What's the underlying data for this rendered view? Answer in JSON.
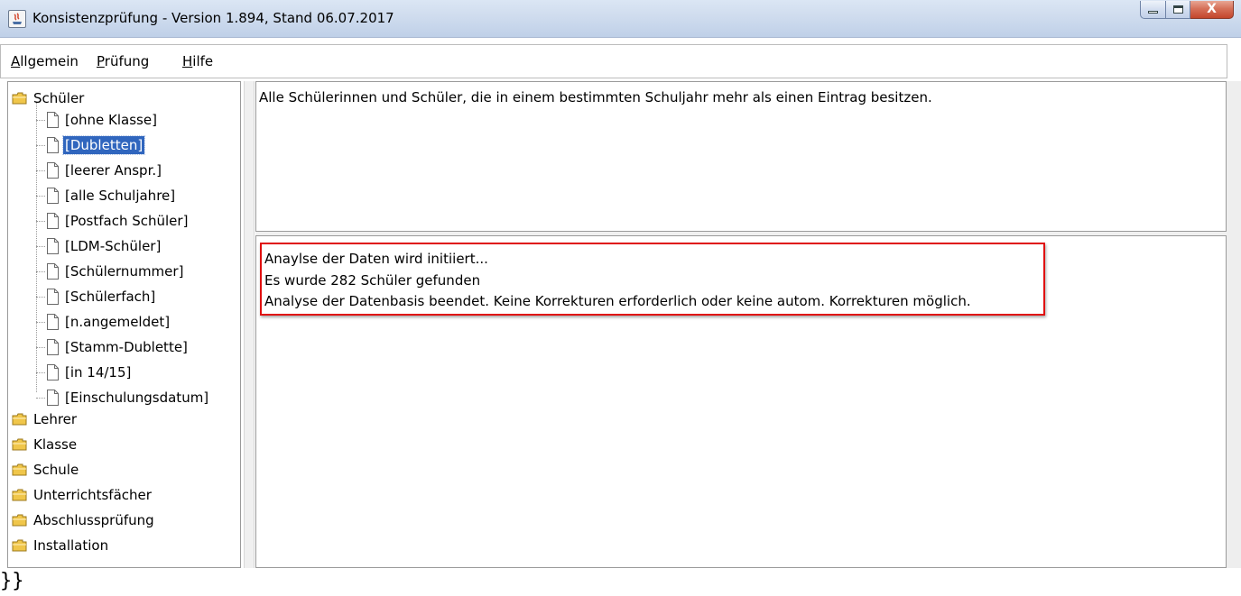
{
  "window": {
    "title": "Konsistenzprüfung - Version 1.894, Stand 06.07.2017",
    "close_glyph": "X"
  },
  "menu": [
    {
      "mnemonic": "A",
      "rest": "llgemein"
    },
    {
      "mnemonic": "P",
      "rest": "rüfung"
    },
    {
      "mnemonic": "H",
      "rest": "ilfe"
    }
  ],
  "tree": {
    "root_expanded": "Schüler",
    "children": [
      "[ohne Klasse]",
      "[Dubletten]",
      "[leerer Anspr.]",
      "[alle Schuljahre]",
      "[Postfach Schüler]",
      "[LDM-Schüler]",
      "[Schülernummer]",
      "[Schülerfach]",
      "[n.angemeldet]",
      "[Stamm-Dublette]",
      "[in 14/15]",
      "[Einschulungsdatum]"
    ],
    "selected": "[Dubletten]",
    "other_roots": [
      "Lehrer",
      "Klasse",
      "Schule",
      "Unterrichtsfächer",
      "Abschlussprüfung",
      "Installation"
    ]
  },
  "description": "Alle Schülerinnen und Schüler, die in einem bestimmten Schuljahr mehr als einen Eintrag besitzen.",
  "log": [
    "Anaylse der Daten wird initiiert...",
    "Es wurde 282 Schüler gefunden",
    "Analyse der Datenbasis beendet. Keine Korrekturen erforderlich oder keine autom. Korrekturen möglich."
  ],
  "trailing_text": "}}",
  "colors": {
    "selection": "#3066be",
    "highlight_box": "#e01010",
    "folder": "#f0c64a"
  },
  "icons": {
    "folder": "folder-icon",
    "document": "document-icon",
    "app": "java-app-icon"
  }
}
